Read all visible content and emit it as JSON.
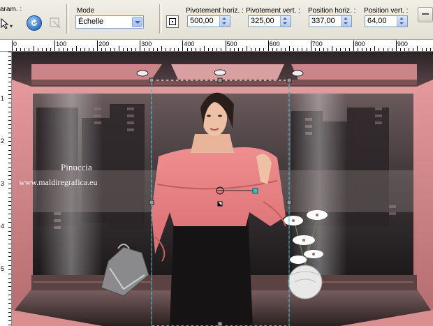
{
  "toolbar": {
    "param_label": "aram. :",
    "mode_label": "Mode",
    "mode_value": "Échelle",
    "rot_h_label": "Pivotement horiz. :",
    "rot_h_value": "500,00",
    "rot_v_label": "Pivotement vert. :",
    "rot_v_value": "325,00",
    "pos_h_label": "Position horiz. :",
    "pos_h_value": "337,00",
    "pos_v_label": "Position vert. :",
    "pos_v_value": "64,00"
  },
  "ruler": {
    "top_labels": [
      "0",
      "100",
      "200",
      "300",
      "400",
      "500",
      "600",
      "700",
      "800",
      "900"
    ],
    "left_labels": [
      "1",
      "2",
      "3",
      "4",
      "5"
    ]
  },
  "canvas": {
    "watermark_line1": "Pinuccia",
    "watermark_line2": "www.maldiregrafica.eu"
  },
  "colors": {
    "accent_pink": "#e8878a",
    "handle_cyan": "#29c4c4"
  }
}
